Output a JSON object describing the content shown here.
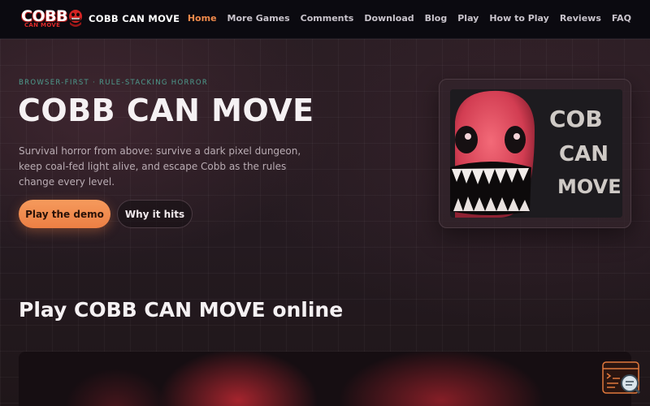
{
  "header": {
    "logo": {
      "line1": "COBB",
      "line2": "CAN MOVE"
    },
    "brand": "COBB CAN MOVE",
    "nav": [
      {
        "label": "Home",
        "active": true
      },
      {
        "label": "More Games"
      },
      {
        "label": "Comments"
      },
      {
        "label": "Download"
      },
      {
        "label": "Blog"
      },
      {
        "label": "Play"
      },
      {
        "label": "How to Play"
      },
      {
        "label": "Reviews"
      },
      {
        "label": "FAQ"
      }
    ]
  },
  "hero": {
    "eyebrow": "BROWSER-FIRST · RULE-STACKING HORROR",
    "title": "COBB CAN MOVE",
    "description": "Survival horror from above: survive a dark pixel dungeon, keep coal-fed light alive, and escape Cobb as the rules change every level.",
    "primary_button": "Play the demo",
    "secondary_button": "Why it hits",
    "art_text": [
      "COB",
      "CAN",
      "MOVE"
    ]
  },
  "play_section": {
    "title": "Play COBB CAN MOVE online"
  },
  "colors": {
    "accent": "#f08a4b",
    "eyebrow": "#4e9c8e",
    "header_bg": "#0b0a10",
    "page_bg": "#24191f"
  },
  "icons": {
    "mascot": "red-creature-icon",
    "floating": "chat-search-icon"
  }
}
